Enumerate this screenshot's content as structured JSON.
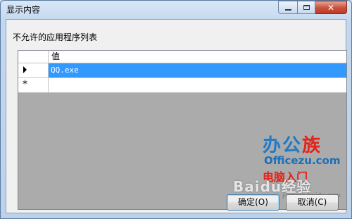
{
  "window": {
    "title": "显示内容",
    "controls": {
      "minimize_icon": "minimize-icon",
      "maximize_icon": "maximize-icon",
      "close_icon": "close-icon",
      "close_glyph": "✕"
    }
  },
  "main": {
    "list_label": "不允许的应用程序列表",
    "grid": {
      "column_header": "值",
      "rows": [
        {
          "marker": "current-row-arrow",
          "value": "QQ.exe",
          "selected": true
        },
        {
          "marker": "new-row-star",
          "star": "*",
          "value": "",
          "selected": false
        }
      ]
    }
  },
  "buttons": {
    "ok_label": "确定(O)",
    "cancel_label": "取消(C)"
  },
  "watermark": {
    "logo_part1": "办公",
    "logo_part2": "族",
    "site": "Officezu.com",
    "slogan": "电脑入门",
    "baidu": "Baidu经验",
    "url": "jingyan.baidu.com"
  },
  "colors": {
    "selection": "#3399ff",
    "close_button": "#c8513b",
    "title_bar": "#c3d8ef"
  }
}
